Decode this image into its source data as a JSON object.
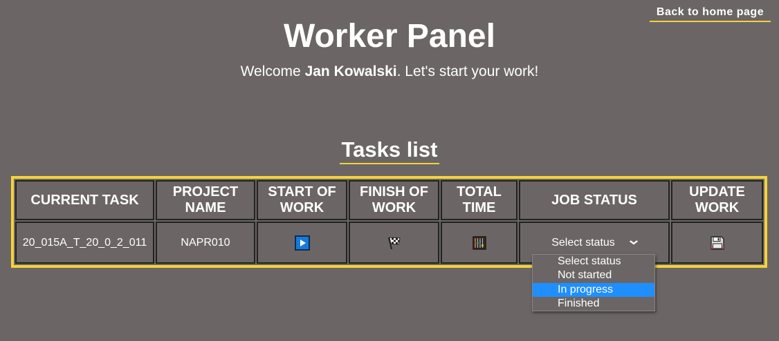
{
  "nav": {
    "home_link": "Back to home page"
  },
  "header": {
    "title": "Worker Panel",
    "welcome_prefix": "Welcome ",
    "user_name": "Jan Kowalski",
    "welcome_suffix": ". Let's start your work!"
  },
  "tasks": {
    "heading": "Tasks list",
    "columns": [
      "CURRENT TASK",
      "PROJECT NAME",
      "START OF WORK",
      "FINISH OF WORK",
      "TOTAL TIME",
      "JOB STATUS",
      "UPDATE WORK"
    ],
    "row": {
      "task": "20_015A_T_20_0_2_011",
      "project": "NAPR010",
      "status_selected": "Select status"
    },
    "icons": {
      "start": "play-icon",
      "finish": "checkered-flag-icon",
      "total": "abacus-icon",
      "update": "floppy-disk-icon",
      "dropdown": "chevron-down-icon"
    },
    "status_options": [
      "Select status",
      "Not started",
      "In progress",
      "Finished"
    ],
    "highlighted_option": "In progress"
  },
  "colors": {
    "background": "#6b6665",
    "accent": "#f5d33a",
    "highlight": "#1f8fff"
  }
}
